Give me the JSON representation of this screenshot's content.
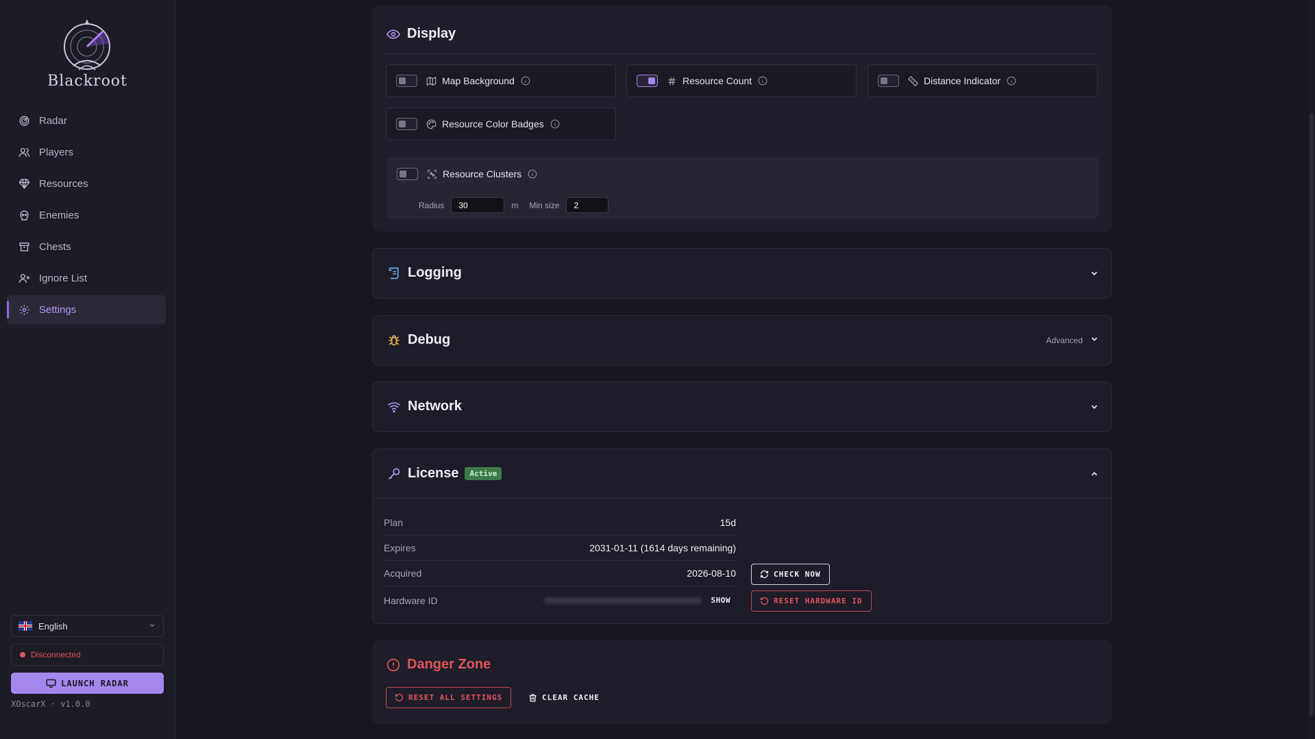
{
  "app": {
    "brand": "Blackroot",
    "user": "XOscarX",
    "version": "v1.0.0"
  },
  "sidebar": {
    "items": [
      {
        "label": "Radar",
        "icon": "radar-icon"
      },
      {
        "label": "Players",
        "icon": "users-icon"
      },
      {
        "label": "Resources",
        "icon": "gem-icon"
      },
      {
        "label": "Enemies",
        "icon": "skull-icon"
      },
      {
        "label": "Chests",
        "icon": "archive-icon"
      },
      {
        "label": "Ignore List",
        "icon": "user-x-icon"
      },
      {
        "label": "Settings",
        "icon": "gear-icon",
        "active": true
      }
    ],
    "language": "English",
    "connection_status": "Disconnected",
    "launch_label": "LAUNCH RADAR",
    "footer": "XOscarX · v1.0.0"
  },
  "display": {
    "title": "Display",
    "options": [
      {
        "label": "Map Background",
        "enabled": false
      },
      {
        "label": "Resource Count",
        "enabled": true
      },
      {
        "label": "Distance Indicator",
        "enabled": false
      },
      {
        "label": "Resource Color Badges",
        "enabled": false
      }
    ],
    "clusters": {
      "label": "Resource Clusters",
      "enabled": false,
      "radius_label": "Radius",
      "radius_value": "30",
      "radius_unit": "m",
      "min_size_label": "Min size",
      "min_size_value": "2"
    }
  },
  "sections": {
    "logging": {
      "title": "Logging"
    },
    "debug": {
      "title": "Debug",
      "tag": "Advanced"
    },
    "network": {
      "title": "Network"
    }
  },
  "license": {
    "title": "License",
    "status": "Active",
    "rows": [
      {
        "label": "Plan",
        "value": "15d"
      },
      {
        "label": "Expires",
        "value": "2031-01-11 (1614 days remaining)"
      },
      {
        "label": "Acquired",
        "value": "2026-08-10"
      },
      {
        "label": "Hardware ID",
        "value": ""
      }
    ],
    "show_label": "SHOW",
    "check_now_label": "CHECK NOW",
    "reset_hwid_label": "RESET HARDWARE ID"
  },
  "danger_zone": {
    "title": "Danger Zone",
    "reset_all_label": "RESET ALL SETTINGS",
    "clear_cache_label": "CLEAR CACHE"
  },
  "colors": {
    "accent": "#a387ec",
    "danger": "#e0545b",
    "success": "#3f7a49",
    "background": "#18161f"
  }
}
